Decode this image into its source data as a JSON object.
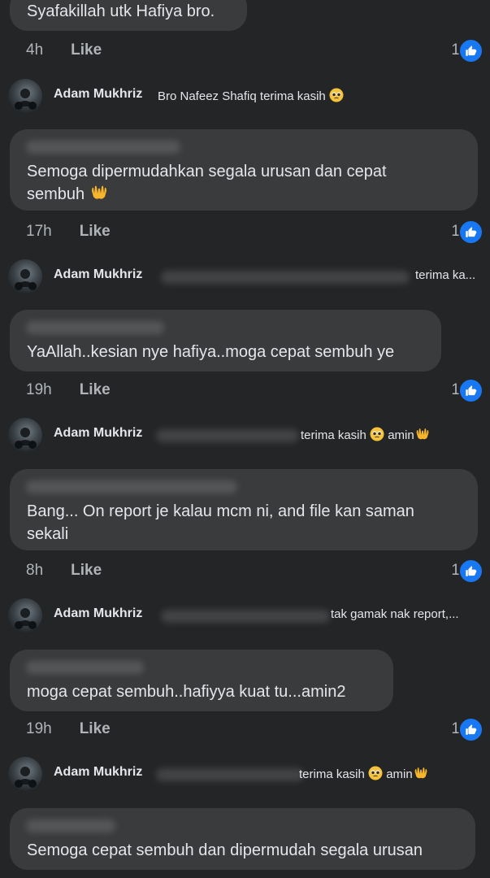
{
  "comments": [
    {
      "text": "Syafakillah utk Hafiya bro.",
      "time": "4h",
      "like": "Like",
      "count": "1"
    },
    {
      "text_line1": "Semoga dipermudahkan segala urusan dan cepat",
      "text_line2": "sembuh",
      "time": "17h",
      "like": "Like",
      "count": "1"
    },
    {
      "text": "YaAllah..kesian nye hafiya..moga cepat sembuh ye",
      "time": "19h",
      "like": "Like",
      "count": "1"
    },
    {
      "text_line1": "Bang... On report je kalau mcm ni, and file kan saman",
      "text_line2": "sekali",
      "time": "8h",
      "like": "Like",
      "count": "1"
    },
    {
      "text": "moga cepat sembuh..hafiyya kuat tu...amin2",
      "time": "19h",
      "like": "Like",
      "count": "1"
    },
    {
      "text": "Semoga cepat sembuh dan dipermudah segala urusan"
    }
  ],
  "replies": [
    {
      "author": "Adam Mukhriz",
      "text": "Bro Nafeez Shafiq terima kasih"
    },
    {
      "author": "Adam Mukhriz",
      "text": "terima ka..."
    },
    {
      "author": "Adam Mukhriz",
      "text": "terima kasih",
      "text2": "amin"
    },
    {
      "author": "Adam Mukhriz",
      "text": "tak gamak nak report,..."
    },
    {
      "author": "Adam Mukhriz",
      "text": "terima kasih",
      "text2": "amin"
    }
  ],
  "icons": {
    "like_badge": "thumbs-up-icon",
    "pleading": "pleading-face-emoji",
    "hands": "open-hands-emoji"
  },
  "colors": {
    "background": "#242526",
    "bubble": "#3a3b3c",
    "like_blue": "#1877f2",
    "meta_text": "#b0b3b8"
  }
}
